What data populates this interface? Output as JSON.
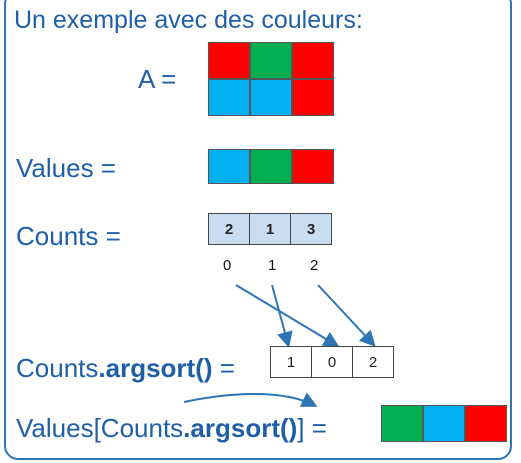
{
  "title": "Un exemple avec des couleurs:",
  "colors": {
    "red": "#ff0000",
    "green": "#00b050",
    "blue": "#00b0f0",
    "text": "#1f5fa8",
    "arrow": "#2e75b6",
    "counts_bg": "#c9dcf0"
  },
  "A": {
    "label": "A =",
    "grid": [
      [
        "red",
        "green",
        "red"
      ],
      [
        "blue",
        "blue",
        "red"
      ]
    ]
  },
  "values": {
    "label": "Values =",
    "cells": [
      "blue",
      "green",
      "red"
    ]
  },
  "counts": {
    "label": "Counts =",
    "cells": [
      "2",
      "1",
      "3"
    ],
    "indices": [
      "0",
      "1",
      "2"
    ]
  },
  "argsort": {
    "prefix": "Counts",
    "method": ".argsort()",
    "equals": " =",
    "cells": [
      "1",
      "0",
      "2"
    ]
  },
  "result": {
    "prefix": "Values[Counts",
    "method": ".argsort()",
    "suffix": "]",
    "equals": " =",
    "cells": [
      "green",
      "blue",
      "red"
    ]
  }
}
